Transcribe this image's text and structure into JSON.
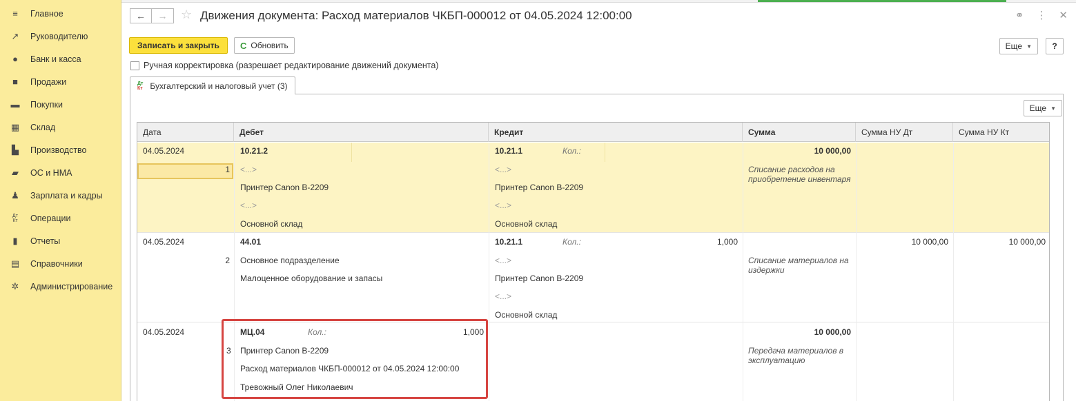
{
  "sidebar": {
    "items": [
      {
        "label": "Главное",
        "icon": "menu-icon"
      },
      {
        "label": "Руководителю",
        "icon": "trend-icon"
      },
      {
        "label": "Банк и касса",
        "icon": "coin-icon"
      },
      {
        "label": "Продажи",
        "icon": "bag-icon"
      },
      {
        "label": "Покупки",
        "icon": "cart-icon"
      },
      {
        "label": "Склад",
        "icon": "warehouse-icon"
      },
      {
        "label": "Производство",
        "icon": "factory-icon"
      },
      {
        "label": "ОС и НМА",
        "icon": "truck-icon"
      },
      {
        "label": "Зарплата и кадры",
        "icon": "person-icon"
      },
      {
        "label": "Операции",
        "icon": "dt-kt-icon"
      },
      {
        "label": "Отчеты",
        "icon": "bar-chart-icon"
      },
      {
        "label": "Справочники",
        "icon": "books-icon"
      },
      {
        "label": "Администрирование",
        "icon": "gear-icon"
      }
    ]
  },
  "header": {
    "title": "Движения документа: Расход материалов ЧКБП-000012 от 04.05.2024 12:00:00"
  },
  "toolbar": {
    "save_close_label": "Записать и закрыть",
    "refresh_label": "Обновить",
    "more_label": "Еще",
    "help_label": "?"
  },
  "manual_correction": {
    "label": "Ручная корректировка (разрешает редактирование движений документа)",
    "checked": false
  },
  "tab": {
    "label": "Бухгалтерский и налоговый учет (3)",
    "icon_top": "Дт",
    "icon_bottom": "Кт"
  },
  "table": {
    "more_label": "Еще",
    "headers": {
      "date": "Дата",
      "debit": "Дебет",
      "credit": "Кредит",
      "sum": "Сумма",
      "sum_nu_dt": "Сумма НУ Дт",
      "sum_nu_kt": "Сумма НУ Кт"
    },
    "rows": [
      {
        "num": "1",
        "date": "04.05.2024",
        "debit_account": "10.21.2",
        "debit_lines": [
          "<...>",
          "Принтер Canon B-2209",
          "<...>",
          "Основной склад"
        ],
        "credit_account": "10.21.1",
        "credit_qty_label": "Кол.:",
        "credit_qty": "",
        "credit_lines": [
          "<...>",
          "Принтер Canon B-2209",
          "<...>",
          "Основной склад"
        ],
        "sum": "10 000,00",
        "description": "Списание расходов на приобретение инвентаря",
        "sum_nu_dt": "",
        "sum_nu_kt": ""
      },
      {
        "num": "2",
        "date": "04.05.2024",
        "debit_account": "44.01",
        "debit_lines": [
          "Основное подразделение",
          "Малоценное оборудование и запасы"
        ],
        "credit_account": "10.21.1",
        "credit_qty_label": "Кол.:",
        "credit_qty": "1,000",
        "credit_lines": [
          "<...>",
          "Принтер Canon B-2209",
          "<...>",
          "Основной склад"
        ],
        "sum": "",
        "description": "Списание материалов на издержки",
        "sum_nu_dt": "10 000,00",
        "sum_nu_kt": "10 000,00"
      },
      {
        "num": "3",
        "date": "04.05.2024",
        "debit_account": "МЦ.04",
        "debit_qty_label": "Кол.:",
        "debit_qty": "1,000",
        "debit_lines": [
          "Принтер Canon B-2209",
          "Расход материалов ЧКБП-000012 от 04.05.2024 12:00:00",
          "Тревожный Олег Николаевич"
        ],
        "sum": "10 000,00",
        "description": "Передача материалов в эксплуатацию"
      }
    ]
  }
}
